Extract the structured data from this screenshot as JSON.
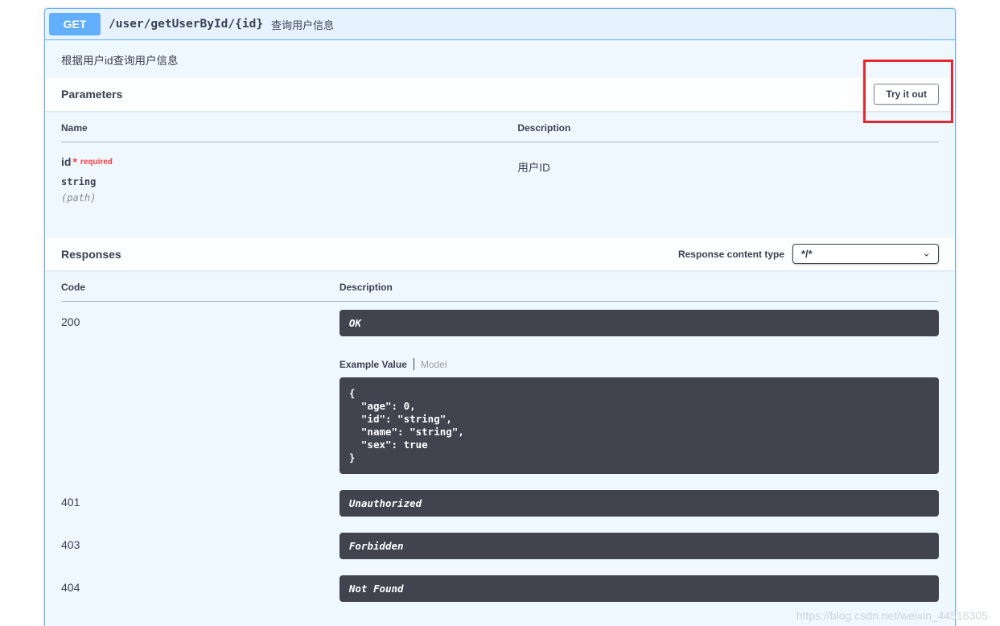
{
  "operation": {
    "method": "GET",
    "path": "/user/getUserById/{id}",
    "summary": "查询用户信息",
    "description": "根据用户id查询用户信息"
  },
  "parameters_section": {
    "title": "Parameters",
    "try_it_out_label": "Try it out",
    "columns": {
      "name": "Name",
      "description": "Description"
    },
    "params": [
      {
        "name": "id",
        "required_star": "*",
        "required_label": "required",
        "type": "string",
        "location": "(path)",
        "description": "用户ID"
      }
    ]
  },
  "responses_section": {
    "title": "Responses",
    "content_type_label": "Response content type",
    "content_type_value": "*/*",
    "columns": {
      "code": "Code",
      "description": "Description"
    },
    "tabs": {
      "example": "Example Value",
      "model": "Model"
    },
    "responses": [
      {
        "code": "200",
        "description": "OK",
        "example": "{\n  \"age\": 0,\n  \"id\": \"string\",\n  \"name\": \"string\",\n  \"sex\": true\n}"
      },
      {
        "code": "401",
        "description": "Unauthorized"
      },
      {
        "code": "403",
        "description": "Forbidden"
      },
      {
        "code": "404",
        "description": "Not Found"
      }
    ]
  },
  "watermark": "https://blog.csdn.net/weixin_44516305",
  "colors": {
    "method_badge": "#61affe",
    "block_border": "#61affe",
    "dark_panel": "#41444e",
    "required_red": "#f93e3e",
    "annotation_red": "#e8262d"
  }
}
